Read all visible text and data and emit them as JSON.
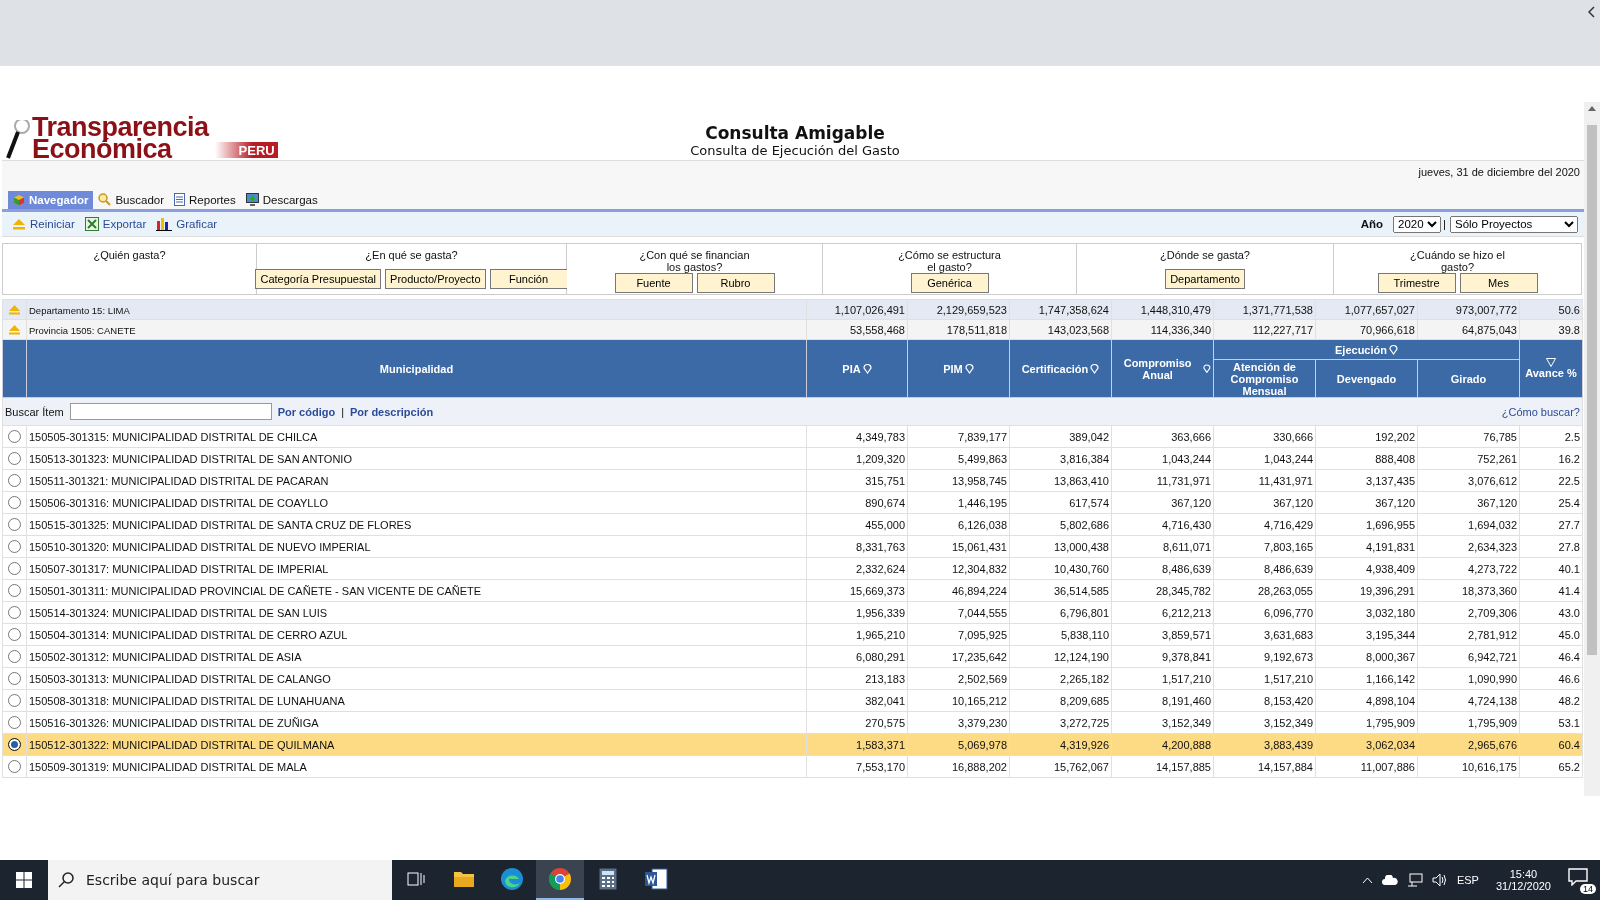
{
  "logo": {
    "line_1": "Transparencia",
    "line_2": "Económica",
    "badge": "PERU"
  },
  "header": {
    "title": "Consulta Amigable",
    "subtitle": "Consulta de Ejecución del Gasto"
  },
  "date": "jueves, 31 de diciembre del 2020",
  "tabs": [
    {
      "label": "Navegador",
      "selected": true
    },
    {
      "label": "Buscador",
      "selected": false
    },
    {
      "label": "Reportes",
      "selected": false
    },
    {
      "label": "Descargas",
      "selected": false
    }
  ],
  "toolbar": {
    "actions": [
      "Reiniciar",
      "Exportar",
      "Graficar"
    ],
    "year_label": "Año",
    "year": "2020",
    "separator": "|",
    "filter": "Sólo Proyectos"
  },
  "questions": [
    {
      "label": "¿Quién gasta?"
    },
    {
      "label": "¿En qué se gasta?",
      "buttons": [
        "Categoría Presupuestal",
        "Producto/Proyecto",
        "Función"
      ]
    },
    {
      "label": "¿Con qué se financian los gastos?",
      "buttons": [
        "Fuente",
        "Rubro"
      ]
    },
    {
      "label": "¿Cómo se estructura el gasto?",
      "buttons": [
        "Genérica"
      ]
    },
    {
      "label": "¿Dónde se gasta?",
      "buttons": [
        "Departamento"
      ]
    },
    {
      "label": "¿Cuándo se hizo el gasto?",
      "buttons": [
        "Trimestre",
        "Mes"
      ]
    }
  ],
  "summary_rows": [
    {
      "label": "Departamento 15: LIMA",
      "values": [
        "1,107,026,491",
        "2,129,659,523",
        "1,747,358,624",
        "1,448,310,479",
        "1,371,771,538",
        "1,077,657,027",
        "973,007,772",
        "50.6"
      ]
    },
    {
      "label": "Provincia 1505: CANETE",
      "values": [
        "53,558,468",
        "178,511,818",
        "143,023,568",
        "114,336,340",
        "112,227,717",
        "70,966,618",
        "64,875,043",
        "39.8"
      ]
    }
  ],
  "table": {
    "name_column": "Municipalidad",
    "columns": [
      {
        "label": "PIA",
        "filter": true
      },
      {
        "label": "PIM",
        "filter": true
      },
      {
        "label": "Certificación",
        "filter": true
      },
      {
        "label": "Compromiso Anual",
        "filter": true
      }
    ],
    "group": {
      "label": "Ejecución",
      "filter": true,
      "columns": [
        "Atención de Compromiso Mensual",
        "Devengado",
        "Girado"
      ]
    },
    "last_column": {
      "label": "Avance %",
      "sorted": true
    },
    "search": {
      "label": "Buscar Ítem",
      "by_code": "Por código",
      "separator": "|",
      "by_description": "Por descripción",
      "help": "¿Cómo buscar?"
    },
    "rows": [
      {
        "selected": false,
        "name": "150505-301315: MUNICIPALIDAD DISTRITAL DE CHILCA",
        "values": [
          "4,349,783",
          "7,839,177",
          "389,042",
          "363,666",
          "330,666",
          "192,202",
          "76,785",
          "2.5"
        ]
      },
      {
        "selected": false,
        "name": "150513-301323: MUNICIPALIDAD DISTRITAL DE SAN ANTONIO",
        "values": [
          "1,209,320",
          "5,499,863",
          "3,816,384",
          "1,043,244",
          "1,043,244",
          "888,408",
          "752,261",
          "16.2"
        ]
      },
      {
        "selected": false,
        "name": "150511-301321: MUNICIPALIDAD DISTRITAL DE PACARAN",
        "values": [
          "315,751",
          "13,958,745",
          "13,863,410",
          "11,731,971",
          "11,431,971",
          "3,137,435",
          "3,076,612",
          "22.5"
        ]
      },
      {
        "selected": false,
        "name": "150506-301316: MUNICIPALIDAD DISTRITAL DE COAYLLO",
        "values": [
          "890,674",
          "1,446,195",
          "617,574",
          "367,120",
          "367,120",
          "367,120",
          "367,120",
          "25.4"
        ]
      },
      {
        "selected": false,
        "name": "150515-301325: MUNICIPALIDAD DISTRITAL DE SANTA CRUZ DE FLORES",
        "values": [
          "455,000",
          "6,126,038",
          "5,802,686",
          "4,716,430",
          "4,716,429",
          "1,696,955",
          "1,694,032",
          "27.7"
        ]
      },
      {
        "selected": false,
        "name": "150510-301320: MUNICIPALIDAD DISTRITAL DE NUEVO IMPERIAL",
        "values": [
          "8,331,763",
          "15,061,431",
          "13,000,438",
          "8,611,071",
          "7,803,165",
          "4,191,831",
          "2,634,323",
          "27.8"
        ]
      },
      {
        "selected": false,
        "name": "150507-301317: MUNICIPALIDAD DISTRITAL DE IMPERIAL",
        "values": [
          "2,332,624",
          "12,304,832",
          "10,430,760",
          "8,486,639",
          "8,486,639",
          "4,938,409",
          "4,273,722",
          "40.1"
        ]
      },
      {
        "selected": false,
        "name": "150501-301311: MUNICIPALIDAD PROVINCIAL DE CAÑETE - SAN VICENTE DE CAÑETE",
        "values": [
          "15,669,373",
          "46,894,224",
          "36,514,585",
          "28,345,782",
          "28,263,055",
          "19,396,291",
          "18,373,360",
          "41.4"
        ]
      },
      {
        "selected": false,
        "name": "150514-301324: MUNICIPALIDAD DISTRITAL DE SAN LUIS",
        "values": [
          "1,956,339",
          "7,044,555",
          "6,796,801",
          "6,212,213",
          "6,096,770",
          "3,032,180",
          "2,709,306",
          "43.0"
        ]
      },
      {
        "selected": false,
        "name": "150504-301314: MUNICIPALIDAD DISTRITAL DE CERRO AZUL",
        "values": [
          "1,965,210",
          "7,095,925",
          "5,838,110",
          "3,859,571",
          "3,631,683",
          "3,195,344",
          "2,781,912",
          "45.0"
        ]
      },
      {
        "selected": false,
        "name": "150502-301312: MUNICIPALIDAD DISTRITAL DE ASIA",
        "values": [
          "6,080,291",
          "17,235,642",
          "12,124,190",
          "9,378,841",
          "9,192,673",
          "8,000,367",
          "6,942,721",
          "46.4"
        ]
      },
      {
        "selected": false,
        "name": "150503-301313: MUNICIPALIDAD DISTRITAL DE CALANGO",
        "values": [
          "213,183",
          "2,502,569",
          "2,265,182",
          "1,517,210",
          "1,517,210",
          "1,166,142",
          "1,090,990",
          "46.6"
        ]
      },
      {
        "selected": false,
        "name": "150508-301318: MUNICIPALIDAD DISTRITAL DE LUNAHUANA",
        "values": [
          "382,041",
          "10,165,212",
          "8,209,685",
          "8,191,460",
          "8,153,420",
          "4,898,104",
          "4,724,138",
          "48.2"
        ]
      },
      {
        "selected": false,
        "name": "150516-301326: MUNICIPALIDAD DISTRITAL DE ZUÑIGA",
        "values": [
          "270,575",
          "3,379,230",
          "3,272,725",
          "3,152,349",
          "3,152,349",
          "1,795,909",
          "1,795,909",
          "53.1"
        ]
      },
      {
        "selected": true,
        "name": "150512-301322: MUNICIPALIDAD DISTRITAL DE QUILMANA",
        "values": [
          "1,583,371",
          "5,069,978",
          "4,319,926",
          "4,200,888",
          "3,883,439",
          "3,062,034",
          "2,965,676",
          "60.4"
        ]
      },
      {
        "selected": false,
        "name": "150509-301319: MUNICIPALIDAD DISTRITAL DE MALA",
        "values": [
          "7,553,170",
          "16,888,202",
          "15,762,067",
          "14,157,885",
          "14,157,884",
          "11,007,886",
          "10,616,175",
          "65.2"
        ]
      }
    ]
  },
  "taskbar": {
    "search_placeholder": "Escribe aquí para buscar",
    "apps": [
      {
        "active": false
      },
      {
        "active": false
      },
      {
        "active": false
      },
      {
        "active": true
      },
      {
        "active": false
      },
      {
        "active": false
      }
    ],
    "language": "ESP",
    "time": "15:40",
    "date": "31/12/2020",
    "notifications": "14"
  }
}
